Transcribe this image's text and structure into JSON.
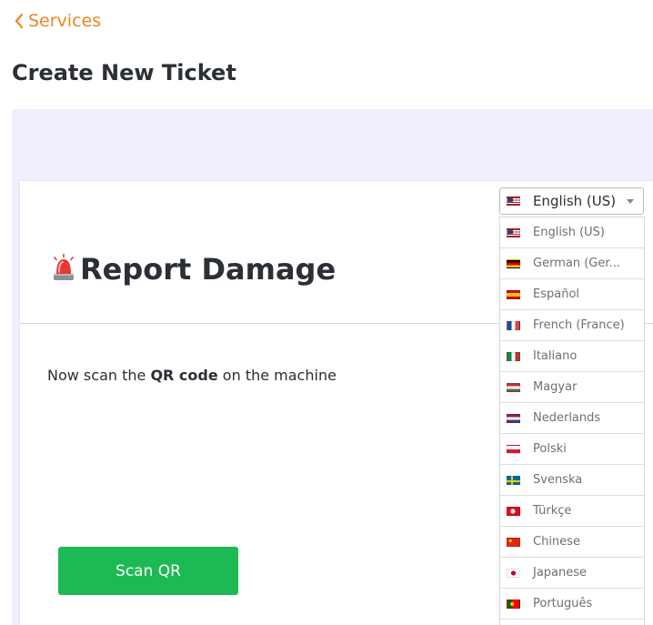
{
  "nav": {
    "back_label": "Services"
  },
  "page": {
    "title": "Create New Ticket"
  },
  "card": {
    "title": "Report Damage",
    "instruction_prefix": "Now scan the ",
    "instruction_bold": "QR code",
    "instruction_suffix": " on the machine",
    "scan_button": "Scan QR"
  },
  "language": {
    "selected": "English (US)",
    "selected_flag": "us-flag-icon",
    "options": [
      {
        "label": "English (US)",
        "flag": "us-flag-icon"
      },
      {
        "label": "German (Ger...",
        "flag": "de-flag-icon"
      },
      {
        "label": "Español",
        "flag": "es-flag-icon"
      },
      {
        "label": "French (France)",
        "flag": "fr-flag-icon"
      },
      {
        "label": "Italiano",
        "flag": "it-flag-icon"
      },
      {
        "label": "Magyar",
        "flag": "hu-flag-icon"
      },
      {
        "label": "Nederlands",
        "flag": "nl-flag-icon"
      },
      {
        "label": "Polski",
        "flag": "pl-flag-icon"
      },
      {
        "label": "Svenska",
        "flag": "se-flag-icon"
      },
      {
        "label": "Türkçe",
        "flag": "tr-flag-icon"
      },
      {
        "label": "Chinese",
        "flag": "cn-flag-icon"
      },
      {
        "label": "Japanese",
        "flag": "jp-flag-icon"
      },
      {
        "label": "Português",
        "flag": "pt-flag-icon"
      }
    ]
  },
  "colors": {
    "accent": "#e8891e",
    "primary_button": "#1db954",
    "band_background": "#eff0fb",
    "text": "#2b2f36"
  }
}
